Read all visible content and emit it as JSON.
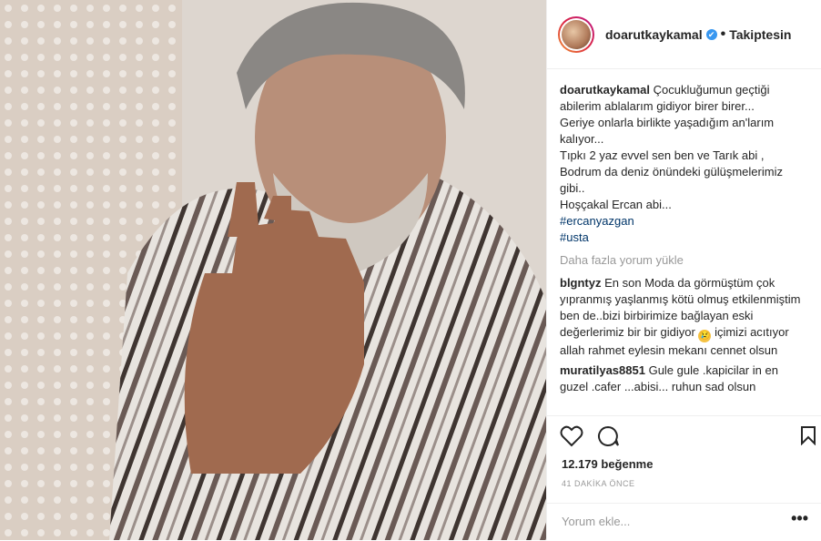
{
  "photo": {
    "description_icon": "post-photo"
  },
  "header": {
    "username": "doarutkaykamal",
    "verified": "✔",
    "separator": "•",
    "follow_status": "Takiptesin"
  },
  "caption": {
    "username": "doarutkaykamal",
    "lines": [
      "Çocukluğumun geçtiği",
      "abilerim ablalarım gidiyor birer birer...",
      "Geriye onlarla birlikte yaşadığım an'larım",
      "kalıyor...",
      "Tıpkı 2 yaz evvel sen ben ve Tarık abi ,",
      "Bodrum da deniz önündeki gülüşmelerimiz",
      "gibi..",
      "Hoşçakal Ercan abi..."
    ],
    "hashtags": [
      "#ercanyazgan",
      "#usta"
    ]
  },
  "load_more": "Daha fazla yorum yükle",
  "comments": [
    {
      "username": "blgntyz",
      "text_before": "En son Moda da görmüştüm çok yıpranmış yaşlanmış kötü olmuş etkilenmiştim ben de..bizi birbirimize bağlayan eski değerlerimiz bir bir gidiyor",
      "emoji": "😢",
      "text_after": "içimizi acıtıyor allah rahmet eylesin mekanı cennet olsun"
    },
    {
      "username": "muratilyas8851",
      "text_before": "Gule gule .kapicilar in en guzel .cafer ...abisi... ruhun sad olsun",
      "emoji": "",
      "text_after": ""
    }
  ],
  "likes": "12.179 beğenme",
  "timestamp": "41 DAKİKA ÖNCE",
  "add_comment": {
    "placeholder": "Yorum ekle...",
    "more": "•••"
  }
}
